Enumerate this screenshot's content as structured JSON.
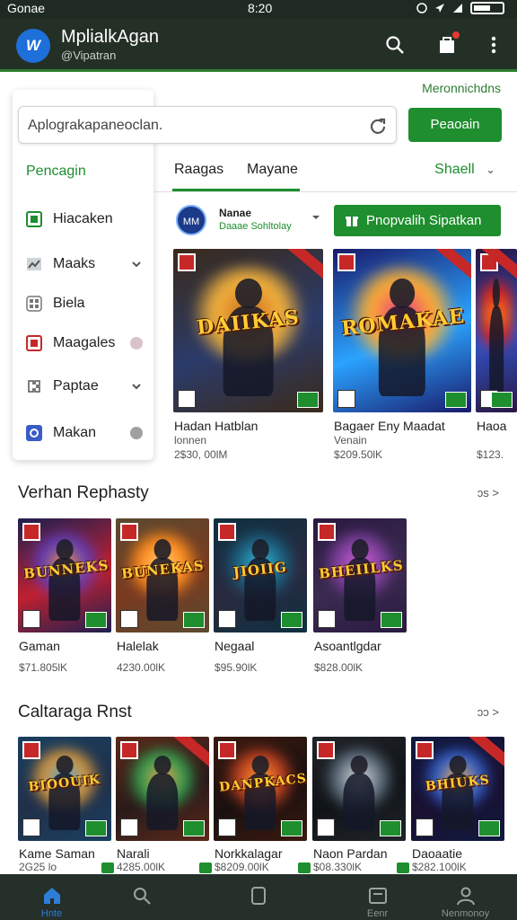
{
  "status_bar": {
    "carrier": "Gonae",
    "time": "8:20"
  },
  "app_bar": {
    "logo_text": "W",
    "title": "MplialkAgan",
    "subtitle": "@Vipatran"
  },
  "menu_link": "Meronnichdns",
  "search": {
    "value": "Aplograkapaneoclan.",
    "placeholder": "Aplograkapaneoclan."
  },
  "primary_button": "Peaoain",
  "side_panel": {
    "title": "Pencagin",
    "items": [
      {
        "label": "Hiacaken",
        "icon": "green-square-icon",
        "trailing": ""
      },
      {
        "label": "Maaks",
        "icon": "chart-icon",
        "trailing": "chevron"
      },
      {
        "label": "Biela",
        "icon": "grid-icon",
        "trailing": ""
      },
      {
        "label": "Maagales",
        "icon": "red-square-icon",
        "trailing": "dot"
      },
      {
        "label": "Paptae",
        "icon": "puzzle-icon",
        "trailing": "chevron"
      },
      {
        "label": "Makan",
        "icon": "blue-square-icon",
        "trailing": "dot"
      }
    ]
  },
  "tabs": {
    "items": [
      "Raagas",
      "Mayane"
    ],
    "active_index": 0,
    "right_label": "Shaell"
  },
  "developer": {
    "avatar_text": "MM",
    "name": "Nanae",
    "sub": "Daaae Sohltolay"
  },
  "promo_button": "Pnopvalih Sipatkan",
  "featured": [
    {
      "art_text": "DAIIKAS",
      "title": "Hadan Hatblan",
      "sub": "lonnen",
      "price": "2$30, 00lM",
      "colors": [
        "#3a2a1a",
        "#c86a1e",
        "#f4b33c",
        "#2b3b6a"
      ]
    },
    {
      "art_text": "ROMAKAE",
      "title": "Bagaer Eny Maadat",
      "sub": "Venain",
      "price": "$209.50lK",
      "colors": [
        "#1a1a6a",
        "#e0338a",
        "#ffb02e",
        "#2aa3ff"
      ]
    },
    {
      "art_text": "",
      "title": "Haoa",
      "sub": "",
      "price": "$123.",
      "colors": [
        "#2a1640",
        "#ff7a1a",
        "#d02020",
        "#3050c0"
      ]
    }
  ],
  "section1": {
    "title": "Verhan Rephasty",
    "more": "ɔs >",
    "items": [
      {
        "art_text": "BUNNEKS",
        "title": "Gaman",
        "price": "$71.805lK",
        "colors": [
          "#1c2050",
          "#ff9a2a",
          "#5a3cc0",
          "#c02030"
        ]
      },
      {
        "art_text": "BUNEKAS",
        "title": "Halelak",
        "price": "4230.00lK",
        "colors": [
          "#5a4a30",
          "#ffd080",
          "#ff8a1a",
          "#7a3a20"
        ]
      },
      {
        "art_text": "JIOIIG",
        "title": "Negaal",
        "price": "$95.90lK",
        "colors": [
          "#0e3040",
          "#3ac0e0",
          "#1a6080",
          "#2a2a40"
        ]
      },
      {
        "art_text": "BHEIILKS",
        "title": "Asoantlgdar",
        "price": "$828.00lK",
        "colors": [
          "#2a1a40",
          "#d060d0",
          "#8040a0",
          "#3a2a50"
        ]
      }
    ]
  },
  "section2": {
    "title": "Caltaraga Rnst",
    "more": "ɔɔ >",
    "items": [
      {
        "art_text": "BIOOUIK",
        "title": "Kame Saman",
        "price": "2G25 lo",
        "colors": [
          "#1a4060",
          "#3aa0e0",
          "#e09a3a",
          "#20304a"
        ]
      },
      {
        "art_text": "",
        "title": "Narali",
        "price": "4285.00lK",
        "colors": [
          "#5a2a1a",
          "#ff9a4a",
          "#30a050",
          "#2a1a1a"
        ]
      },
      {
        "art_text": "DANPKACS",
        "title": "Norkkalagar",
        "price": "$8209.00lK",
        "colors": [
          "#3a1a10",
          "#ffa030",
          "#c04020",
          "#1a1010"
        ]
      },
      {
        "art_text": "",
        "title": "Naon Pardan",
        "price": "$08.330lK",
        "colors": [
          "#202428",
          "#e0e0e0",
          "#607080",
          "#101418"
        ]
      },
      {
        "art_text": "BHIUKS",
        "title": "Daoaatie",
        "price": "$282.100lK",
        "colors": [
          "#101a40",
          "#ffb040",
          "#3060d0",
          "#1a1030"
        ]
      }
    ]
  },
  "bottom_nav": [
    {
      "label": "Hnte",
      "icon": "home-icon",
      "active": true
    },
    {
      "label": "",
      "icon": "search-icon",
      "active": false
    },
    {
      "label": "",
      "icon": "tablet-icon",
      "active": false
    },
    {
      "label": "Eenr",
      "icon": "inbox-icon",
      "active": false
    },
    {
      "label": "Nenmonoy",
      "icon": "profile-icon",
      "active": false
    }
  ]
}
